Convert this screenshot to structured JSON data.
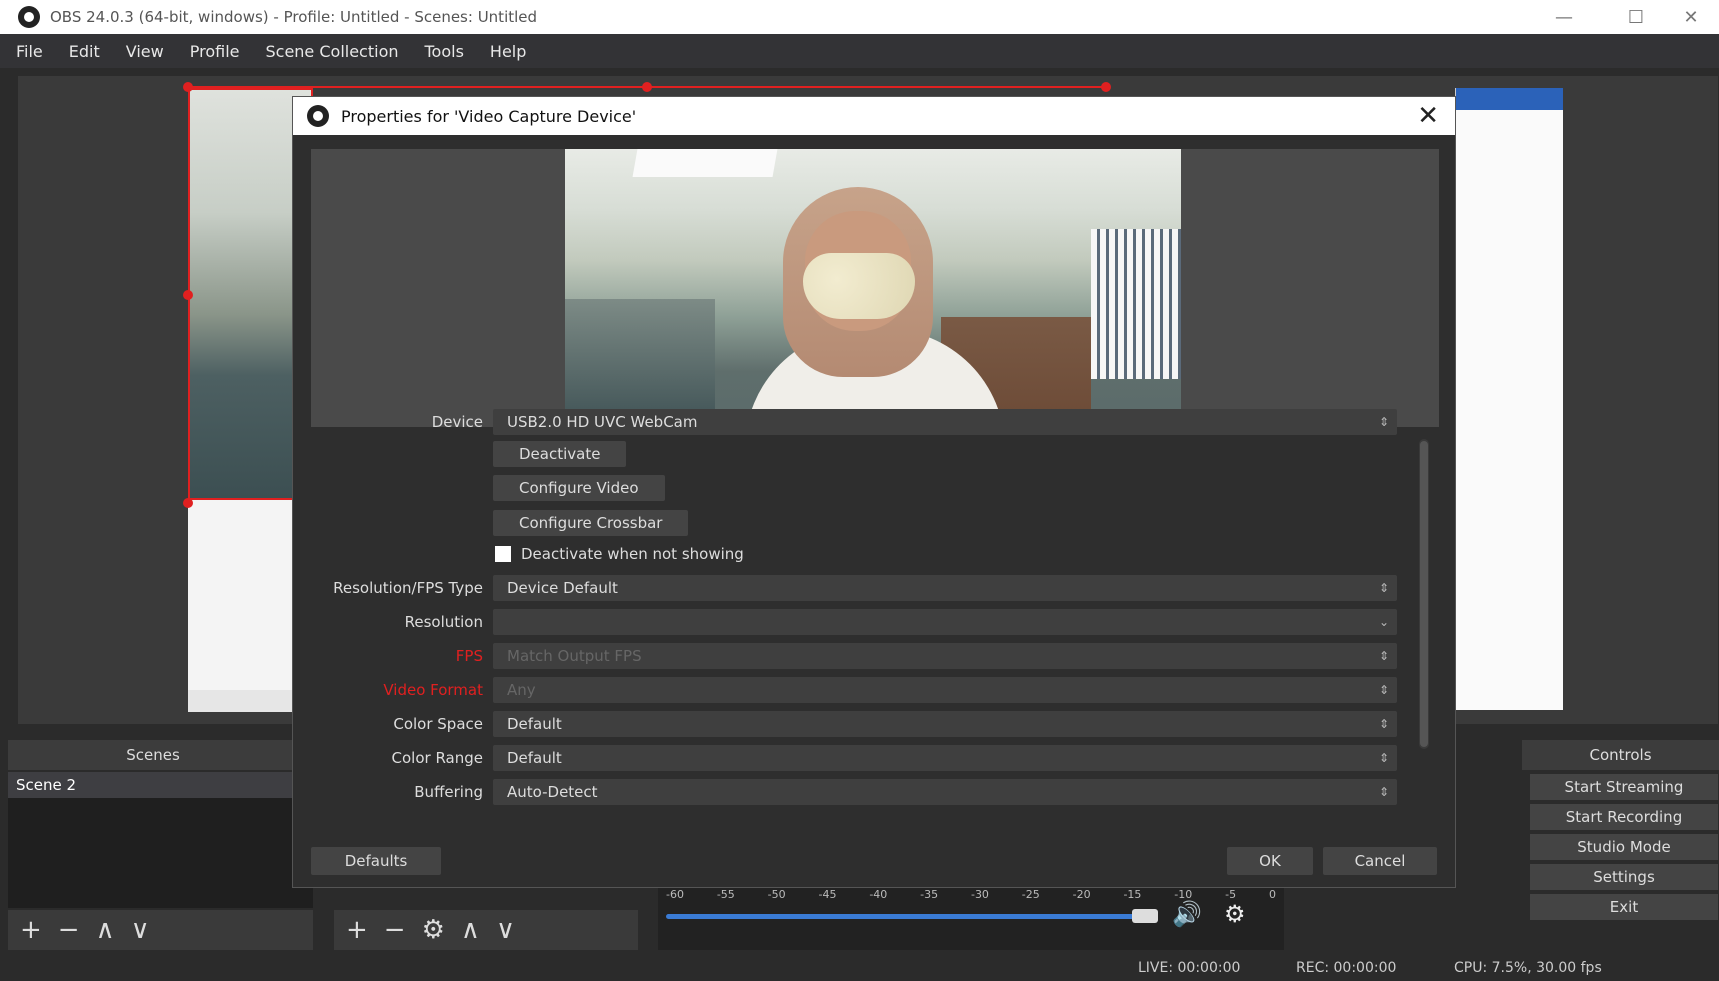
{
  "app": {
    "title": "OBS 24.0.3 (64-bit, windows) - Profile: Untitled - Scenes: Untitled",
    "window_controls": {
      "minimize": "—",
      "maximize": "☐",
      "close": "✕"
    }
  },
  "menu": [
    "File",
    "Edit",
    "View",
    "Profile",
    "Scene Collection",
    "Tools",
    "Help"
  ],
  "dialog": {
    "title": "Properties for 'Video Capture Device'",
    "close_glyph": "✕",
    "fields": {
      "device": {
        "label": "Device",
        "value": "USB2.0 HD UVC WebCam"
      },
      "deactivate_button": "Deactivate",
      "configure_video_button": "Configure Video",
      "configure_crossbar_button": "Configure Crossbar",
      "deactivate_when_not_showing": {
        "label": "Deactivate when not showing",
        "checked": false
      },
      "resolution_fps_type": {
        "label": "Resolution/FPS Type",
        "value": "Device Default"
      },
      "resolution": {
        "label": "Resolution",
        "value": ""
      },
      "fps": {
        "label": "FPS",
        "value": "Match Output FPS"
      },
      "video_format": {
        "label": "Video Format",
        "value": "Any"
      },
      "color_space": {
        "label": "Color Space",
        "value": "Default"
      },
      "color_range": {
        "label": "Color Range",
        "value": "Default"
      },
      "buffering": {
        "label": "Buffering",
        "value": "Auto-Detect"
      }
    },
    "footer": {
      "defaults": "Defaults",
      "ok": "OK",
      "cancel": "Cancel"
    }
  },
  "docks": {
    "scenes": {
      "header": "Scenes",
      "items": [
        "Scene 2"
      ]
    },
    "controls": {
      "header": "Controls",
      "buttons": [
        "Start Streaming",
        "Start Recording",
        "Studio Mode",
        "Settings",
        "Exit"
      ]
    }
  },
  "mixer": {
    "ticks": [
      "-60",
      "-55",
      "-50",
      "-45",
      "-40",
      "-35",
      "-30",
      "-25",
      "-20",
      "-15",
      "-10",
      "-5",
      "0"
    ]
  },
  "status": {
    "live": "LIVE: 00:00:00",
    "rec": "REC: 00:00:00",
    "cpu": "CPU: 7.5%, 30.00 fps"
  },
  "colors": {
    "selection_red": "#e02020",
    "accent_blue": "#3a7bd5",
    "dark_bg": "#2b2b2b"
  }
}
